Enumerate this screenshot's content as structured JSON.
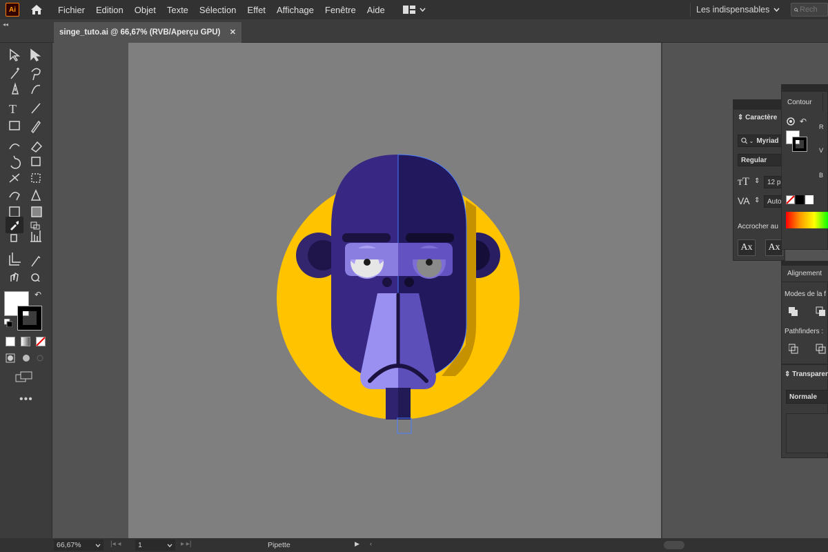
{
  "app": {
    "logo_text": "Ai"
  },
  "menu": {
    "items": [
      "Fichier",
      "Edition",
      "Objet",
      "Texte",
      "Sélection",
      "Effet",
      "Affichage",
      "Fenêtre",
      "Aide"
    ],
    "workspace_label": "Les indispensables",
    "search_placeholder": "Rech"
  },
  "document_tab": {
    "title": "singe_tuto.ai @ 66,67% (RVB/Aperçu GPU)",
    "close_glyph": "✕"
  },
  "status_bar": {
    "zoom": "66,67%",
    "artboard_number": "1",
    "current_tool": "Pipette"
  },
  "panels": {
    "caractere": {
      "title": "Caractère",
      "font_family": "Myriad P",
      "font_style": "Regular",
      "font_size": "12 p",
      "leading": "Auto",
      "snap_label": "Accrocher au",
      "btn1": "Ax",
      "btn2": "Ax"
    },
    "contour": {
      "tab_label": "Contour",
      "r_label": "R",
      "v_label": "V",
      "b_label": "B"
    },
    "alignement": {
      "title": "Alignement",
      "modes_label": "Modes de la f",
      "pathfinders_label": "Pathfinders :"
    },
    "transparence": {
      "title": "Transparen",
      "blend_mode": "Normale"
    }
  },
  "colors": {
    "accent_yellow": "#ffc300",
    "ape_fur_light": "#3a2a8a",
    "ape_fur_dark": "#22185a",
    "ape_face_light": "#9b8ff0",
    "ape_face_dark": "#6a58c8",
    "selection_blue": "#4a7dff"
  },
  "icons": {
    "home": "home-icon",
    "layout": "layout-grid-icon",
    "search": "search-icon",
    "eyedropper_tool": "eyedropper-icon"
  }
}
